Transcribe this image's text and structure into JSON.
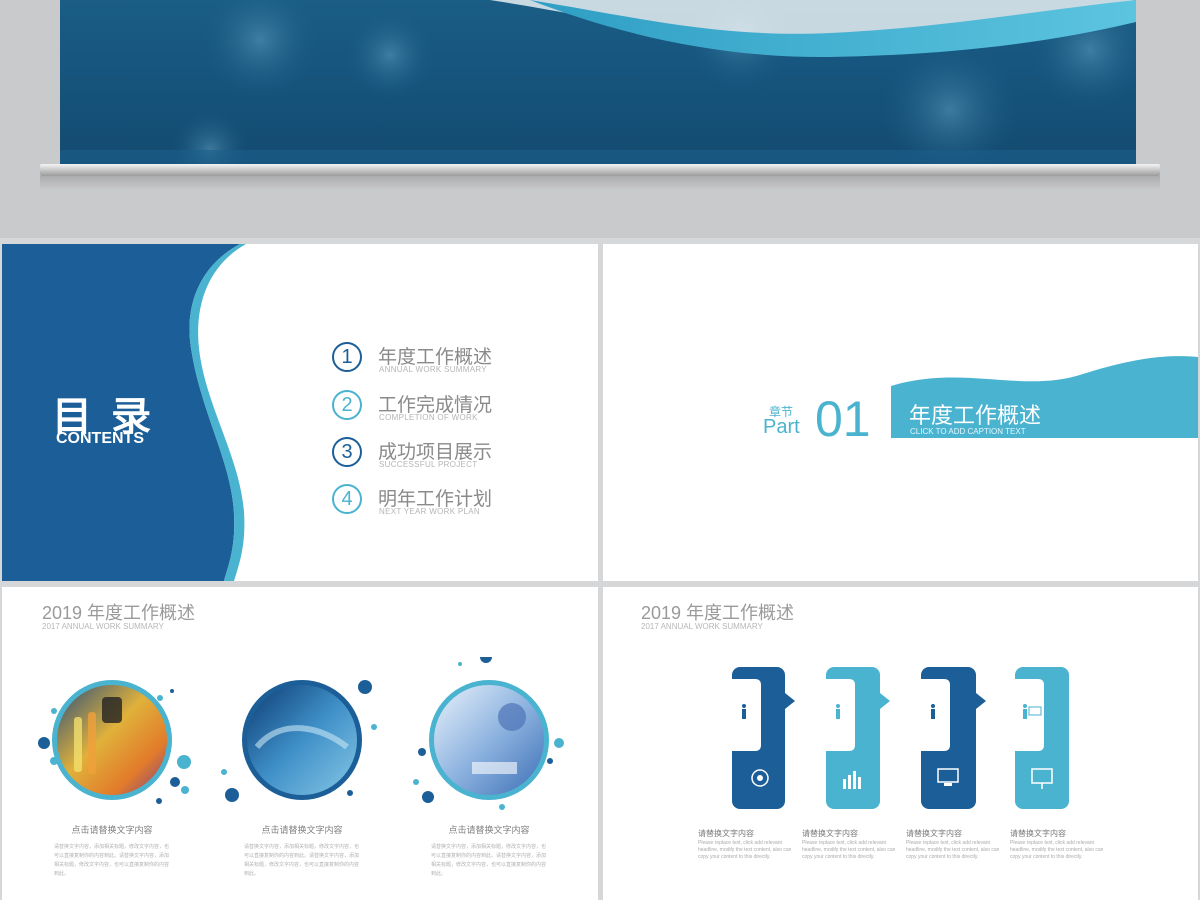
{
  "colors": {
    "dark_blue": "#1c5f98",
    "light_blue": "#4ab3cf",
    "mid_blue": "#2a75b3",
    "gray_text": "#8a8a8a"
  },
  "contents_slide": {
    "title": "目 录",
    "subtitle": "CONTENTS",
    "items": [
      {
        "num": "1",
        "title": "年度工作概述",
        "sub": "ANNUAL WORK SUMMARY"
      },
      {
        "num": "2",
        "title": "工作完成情况",
        "sub": "COMPLETION OF WORK"
      },
      {
        "num": "3",
        "title": "成功项目展示",
        "sub": "SUCCESSFUL PROJECT"
      },
      {
        "num": "4",
        "title": "明年工作计划",
        "sub": "NEXT YEAR WORK PLAN"
      }
    ]
  },
  "part_slide": {
    "chapter": "章节",
    "part": "Part",
    "number": "01",
    "title": "年度工作概述",
    "caption": "CLICK TO ADD CAPTION TEXT"
  },
  "summary_circles_slide": {
    "title": "2019 年度工作概述",
    "sub": "2017 ANNUAL WORK SUMMARY",
    "items": [
      {
        "caption": "点击请替换文字内容",
        "body": "请替换文字内容，添加相关标题，修改文字内容，也可以直接复制你的内容到此。请替换文字内容，添加相关标题，修改文字内容，也可以直接复制你的内容到此。"
      },
      {
        "caption": "点击请替换文字内容",
        "body": "请替换文字内容，添加相关标题，修改文字内容，也可以直接复制你的内容到此。请替换文字内容，添加相关标题，修改文字内容，也可以直接复制你的内容到此。"
      },
      {
        "caption": "点击请替换文字内容",
        "body": "请替换文字内容，添加相关标题，修改文字内容，也可以直接复制你的内容到此。请替换文字内容，添加相关标题，修改文字内容，也可以直接复制你的内容到此。"
      }
    ]
  },
  "summary_cards_slide": {
    "title": "2019 年度工作概述",
    "sub": "2017 ANNUAL WORK SUMMARY",
    "items": [
      {
        "caption": "请替换文字内容",
        "body": "Please replace text, click add relevant headline, modify the text content, also can copy your content to this directly.",
        "icon": "head-gear-icon"
      },
      {
        "caption": "请替换文字内容",
        "body": "Please replace text, click add relevant headline, modify the text content, also can copy your content to this directly.",
        "icon": "bar-chart-icon"
      },
      {
        "caption": "请替换文字内容",
        "body": "Please replace text, click add relevant headline, modify the text content, also can copy your content to this directly.",
        "icon": "computer-hand-icon"
      },
      {
        "caption": "请替换文字内容",
        "body": "Please replace text, click add relevant headline, modify the text content, also can copy your content to this directly.",
        "icon": "presentation-icon"
      }
    ]
  }
}
